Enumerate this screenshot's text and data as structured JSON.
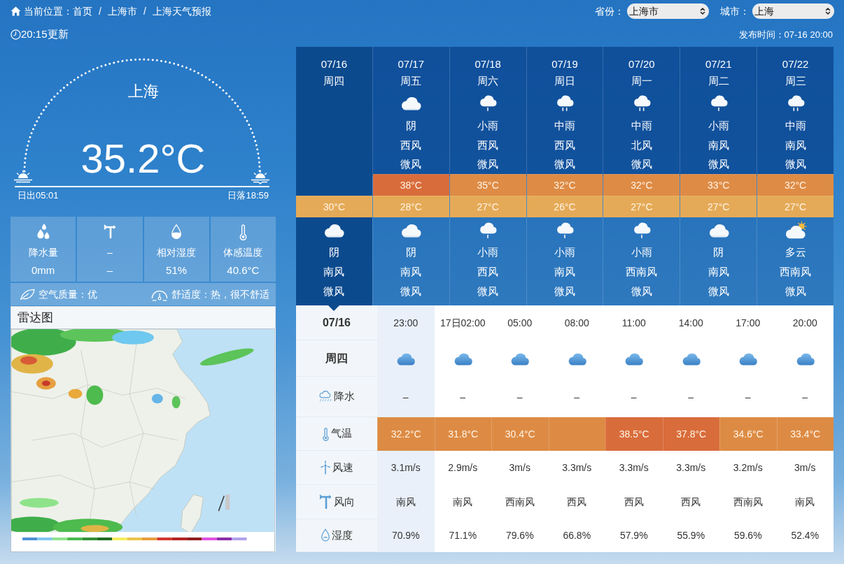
{
  "breadcrumb": {
    "label": "当前位置：",
    "items": [
      {
        "kind": "link",
        "text": "首页"
      },
      {
        "kind": "separator",
        "text": "/"
      },
      {
        "kind": "link",
        "text": "上海市"
      },
      {
        "kind": "separator",
        "text": "/"
      },
      {
        "kind": "link",
        "text": "上海天气预报"
      }
    ]
  },
  "selectors": [
    {
      "label": "省份：",
      "value": "上海市"
    },
    {
      "label": "城市：",
      "value": "上海"
    }
  ],
  "update_time": "20:15更新",
  "publish_time": "发布时间：07-16 20:00",
  "current": {
    "city": "上海",
    "temperature": "35.2°C",
    "sunrise": "日出05:01",
    "sunset": "日落18:59"
  },
  "stats": [
    {
      "kind": "precip",
      "label": "降水量",
      "value": "0mm"
    },
    {
      "kind": "wind",
      "label": "–",
      "value": "–"
    },
    {
      "kind": "humidity",
      "label": "相对湿度",
      "value": "51%"
    },
    {
      "kind": "feels",
      "label": "体感温度",
      "value": "40.6°C"
    }
  ],
  "air_quality": "空气质量：优",
  "comfort": "舒适度：热，很不舒适",
  "radar": {
    "title": "雷达图"
  },
  "daily": [
    {
      "date": "07/16",
      "weekday": "周四",
      "selected": true,
      "low": {
        "text": "30°C",
        "color": "#e5aa57"
      },
      "night": {
        "kind": "cloud",
        "weather": "阴",
        "wind_dir": "南风",
        "wind_level": "微风"
      }
    },
    {
      "date": "07/17",
      "weekday": "周五",
      "selected": false,
      "day": {
        "kind": "cloud",
        "weather": "阴",
        "wind_dir": "西风",
        "wind_level": "微风"
      },
      "high": {
        "text": "38°C",
        "color": "#d96c3b"
      },
      "low": {
        "text": "28°C",
        "color": "#e5aa57"
      },
      "night": {
        "kind": "cloud",
        "weather": "阴",
        "wind_dir": "南风",
        "wind_level": "微风"
      }
    },
    {
      "date": "07/18",
      "weekday": "周六",
      "selected": false,
      "day": {
        "kind": "light-rain",
        "weather": "小雨",
        "wind_dir": "西风",
        "wind_level": "微风"
      },
      "high": {
        "text": "35°C",
        "color": "#de8b45"
      },
      "low": {
        "text": "27°C",
        "color": "#e5aa57"
      },
      "night": {
        "kind": "light-rain",
        "weather": "小雨",
        "wind_dir": "西风",
        "wind_level": "微风"
      }
    },
    {
      "date": "07/19",
      "weekday": "周日",
      "selected": false,
      "day": {
        "kind": "moderate-rain",
        "weather": "中雨",
        "wind_dir": "西风",
        "wind_level": "微风"
      },
      "high": {
        "text": "32°C",
        "color": "#de8b45"
      },
      "low": {
        "text": "26°C",
        "color": "#e5aa57"
      },
      "night": {
        "kind": "light-rain",
        "weather": "小雨",
        "wind_dir": "南风",
        "wind_level": "微风"
      }
    },
    {
      "date": "07/20",
      "weekday": "周一",
      "selected": false,
      "day": {
        "kind": "moderate-rain",
        "weather": "中雨",
        "wind_dir": "北风",
        "wind_level": "微风"
      },
      "high": {
        "text": "32°C",
        "color": "#de8b45"
      },
      "low": {
        "text": "27°C",
        "color": "#e5aa57"
      },
      "night": {
        "kind": "light-rain",
        "weather": "小雨",
        "wind_dir": "西南风",
        "wind_level": "微风"
      }
    },
    {
      "date": "07/21",
      "weekday": "周二",
      "selected": false,
      "day": {
        "kind": "light-rain",
        "weather": "小雨",
        "wind_dir": "南风",
        "wind_level": "微风"
      },
      "high": {
        "text": "33°C",
        "color": "#de8b45"
      },
      "low": {
        "text": "27°C",
        "color": "#e5aa57"
      },
      "night": {
        "kind": "cloud",
        "weather": "阴",
        "wind_dir": "南风",
        "wind_level": "微风"
      }
    },
    {
      "date": "07/22",
      "weekday": "周三",
      "selected": false,
      "day": {
        "kind": "moderate-rain",
        "weather": "中雨",
        "wind_dir": "南风",
        "wind_level": "微风"
      },
      "high": {
        "text": "32°C",
        "color": "#de8b45"
      },
      "low": {
        "text": "27°C",
        "color": "#e5aa57"
      },
      "night": {
        "kind": "partly-cloudy",
        "weather": "多云",
        "wind_dir": "西南风",
        "wind_level": "微风"
      }
    }
  ],
  "hourly": {
    "date": "07/16",
    "weekday": "周四",
    "rows": [
      {
        "kind": "precip",
        "label": "降水"
      },
      {
        "kind": "temp",
        "label": "气温"
      },
      {
        "kind": "wind_speed",
        "label": "风速"
      },
      {
        "kind": "wind_dir",
        "label": "风向"
      },
      {
        "kind": "humidity",
        "label": "湿度"
      }
    ],
    "hours": [
      {
        "time": "23:00",
        "selected": true,
        "kind": "cloud",
        "precip": "–",
        "temp": "32.2°C",
        "color": "#dd8b44",
        "wind_speed": "3.1m/s",
        "wind_dir": "南风",
        "humidity": "70.9%"
      },
      {
        "time": "17日02:00",
        "selected": false,
        "kind": "cloud",
        "precip": "–",
        "temp": "31.8°C",
        "color": "#dd8b44",
        "wind_speed": "2.9m/s",
        "wind_dir": "南风",
        "humidity": "71.1%"
      },
      {
        "time": "05:00",
        "selected": false,
        "kind": "cloud",
        "precip": "–",
        "temp": "30.4°C",
        "color": "#dd8b44",
        "wind_speed": "3m/s",
        "wind_dir": "西南风",
        "humidity": "79.6%"
      },
      {
        "time": "08:00",
        "selected": false,
        "kind": "cloud",
        "precip": "–",
        "color": "#dd8b44",
        "wind_speed": "3.3m/s",
        "wind_dir": "西风",
        "humidity": "66.8%"
      },
      {
        "time": "11:00",
        "selected": false,
        "kind": "cloud",
        "precip": "–",
        "temp": "38.5°C",
        "color": "#d96c3b",
        "wind_speed": "3.3m/s",
        "wind_dir": "西风",
        "humidity": "57.9%"
      },
      {
        "time": "14:00",
        "selected": false,
        "kind": "cloud",
        "precip": "–",
        "temp": "37.8°C",
        "color": "#d96c3b",
        "wind_speed": "3.3m/s",
        "wind_dir": "西风",
        "humidity": "55.9%"
      },
      {
        "time": "17:00",
        "selected": false,
        "kind": "cloud",
        "precip": "–",
        "temp": "34.6°C",
        "color": "#dd8b44",
        "wind_speed": "3.2m/s",
        "wind_dir": "西南风",
        "humidity": "59.6%"
      },
      {
        "time": "20:00",
        "selected": false,
        "kind": "cloud",
        "precip": "–",
        "temp": "33.4°C",
        "color": "#dd8b44",
        "wind_speed": "3m/s",
        "wind_dir": "南风",
        "humidity": "52.4%"
      }
    ]
  }
}
